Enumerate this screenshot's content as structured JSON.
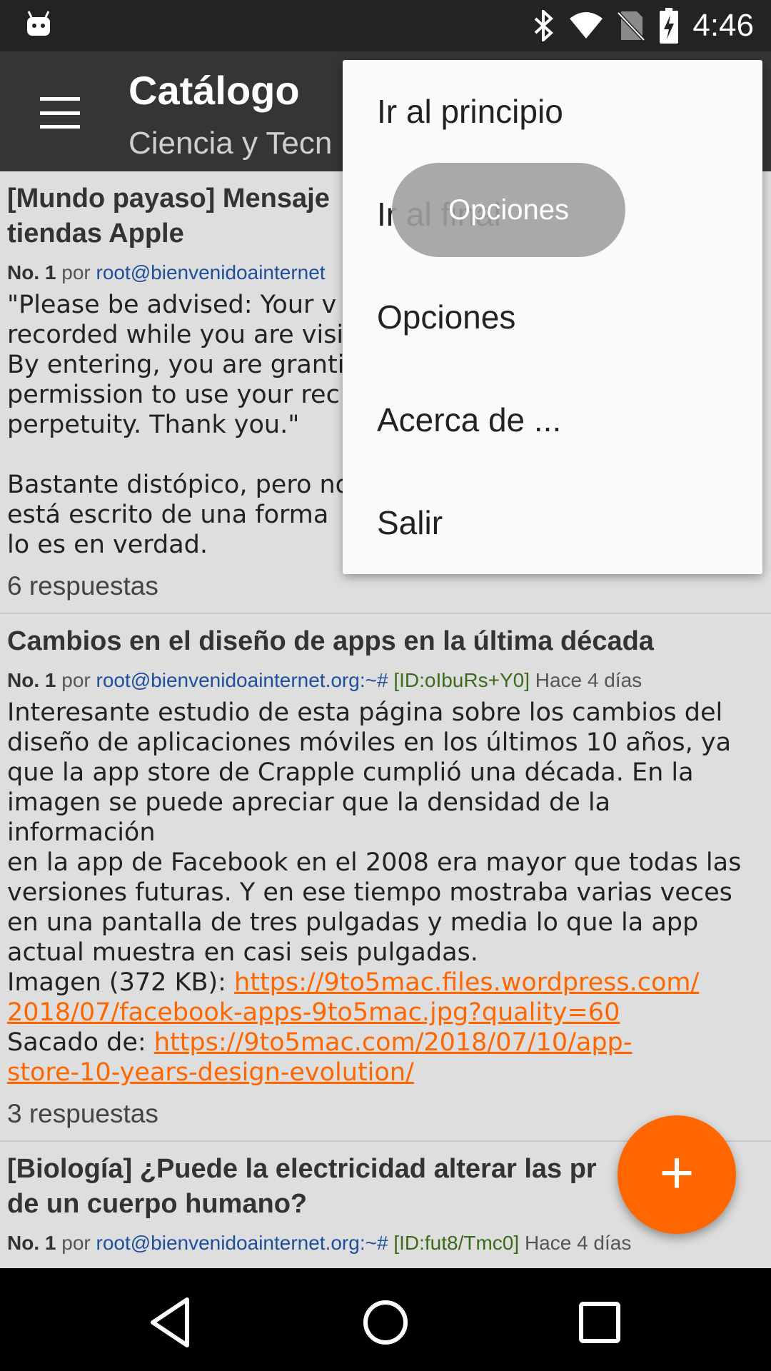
{
  "status_bar": {
    "time": "4:46",
    "icons": [
      "android-icon",
      "bluetooth-icon",
      "wifi-icon",
      "no-sim-icon",
      "battery-charging-icon"
    ]
  },
  "toolbar": {
    "title": "Catálogo",
    "subtitle": "Ciencia y Tecn",
    "menu_icon": "hamburger-icon"
  },
  "overflow_menu": {
    "items": [
      {
        "label": "Ir al principio"
      },
      {
        "label": "Ir al final"
      },
      {
        "label": "Opciones"
      },
      {
        "label": "Acerca de ..."
      },
      {
        "label": "Salir"
      }
    ]
  },
  "toast": {
    "text": "Opciones"
  },
  "posts": [
    {
      "title": "[Mundo payaso] Mensaje\ntiendas Apple",
      "no": "No. 1",
      "por": "por",
      "author": "root@bienvenidoainternet",
      "id": "",
      "date": "",
      "body": "\"Please be advised: Your v\nrecorded while you are visi\nBy entering, you are granti\npermission to use your rec\nperpetuity. Thank you.\"\n\nBastante distópico, pero no\nestá escrito de una forma \nlo es en verdad.",
      "replies": "6 respuestas"
    },
    {
      "title": "Cambios en el diseño de apps en la última década",
      "no": "No. 1",
      "por": "por",
      "author": "root@bienvenidoainternet.org:~#",
      "id": "[ID:oIbuRs+Y0]",
      "date": "Hace 4 días",
      "body": "Interesante estudio de esta página sobre los cambios del\ndiseño de aplicaciones móviles en los últimos 10 años, ya\nque la app store de Crapple cumplió una década. En la\nimagen se puede apreciar que la densidad de la información\nen la app de Facebook en el 2008 era mayor que todas las\nversiones futuras. Y en ese tiempo mostraba varias veces\nen una pantalla de tres pulgadas y media lo que la app\nactual muestra en casi seis pulgadas.\n",
      "image_label": "Imagen (372 KB): ",
      "image_link": "https://9to5mac.files.wordpress.com/\n2018/07/facebook-apps-9to5mac.jpg?quality=60",
      "source_label": "Sacado de: ",
      "source_link": "https://9to5mac.com/2018/07/10/app-\nstore-10-years-design-evolution/",
      "replies": "3 respuestas"
    },
    {
      "title": "[Biología] ¿Puede la electricidad alterar las pr      es\nde un cuerpo humano?",
      "no": "No. 1",
      "por": "por",
      "author": "root@bienvenidoainternet.org:~#",
      "id": "[ID:fut8/Tmc0]",
      "date": "Hace 4 días"
    }
  ],
  "fab": {
    "icon": "plus-icon",
    "label": "+"
  },
  "nav_bar": {
    "icons": [
      "back-icon",
      "home-icon",
      "recents-icon"
    ]
  },
  "colors": {
    "accent": "#ff6600",
    "toolbar": "#353535",
    "status_bar": "#232323",
    "link": "#1d4f9c",
    "id": "#3a6a1a"
  }
}
